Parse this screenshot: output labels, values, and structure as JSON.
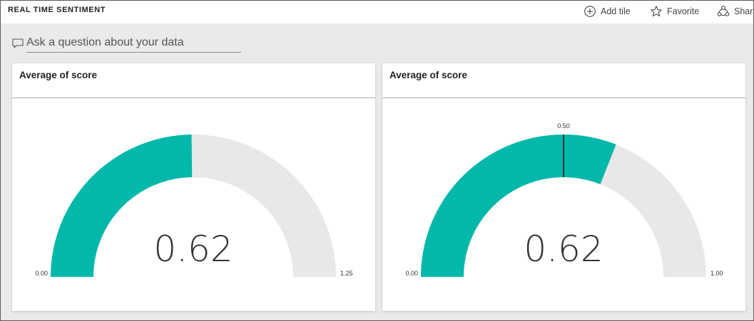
{
  "app": {
    "title": "REAL TIME SENTIMENT"
  },
  "toolbar": {
    "add_tile": {
      "label": "Add tile",
      "icon": "plus-circle-icon"
    },
    "favorite": {
      "label": "Favorite",
      "icon": "star-icon"
    },
    "share": {
      "label": "Share",
      "icon": "share-icon"
    }
  },
  "qna": {
    "placeholder": "Ask a question about your data",
    "icon": "speech-bubble-icon"
  },
  "colors": {
    "fill": "#01b8aa",
    "track": "#e8e8e8",
    "target": "#333333"
  },
  "tiles": [
    {
      "title": "Average of score",
      "gauge": {
        "value": 0.62,
        "value_label": "0.62",
        "min": 0,
        "max": 1.25,
        "min_label": "0.00",
        "max_label": "1.25",
        "target": null,
        "target_label": ""
      }
    },
    {
      "title": "Average of score",
      "gauge": {
        "value": 0.62,
        "value_label": "0.62",
        "min": 0,
        "max": 1,
        "min_label": "0.00",
        "max_label": "1.00",
        "target": 0.5,
        "target_label": "0.50"
      }
    }
  ]
}
